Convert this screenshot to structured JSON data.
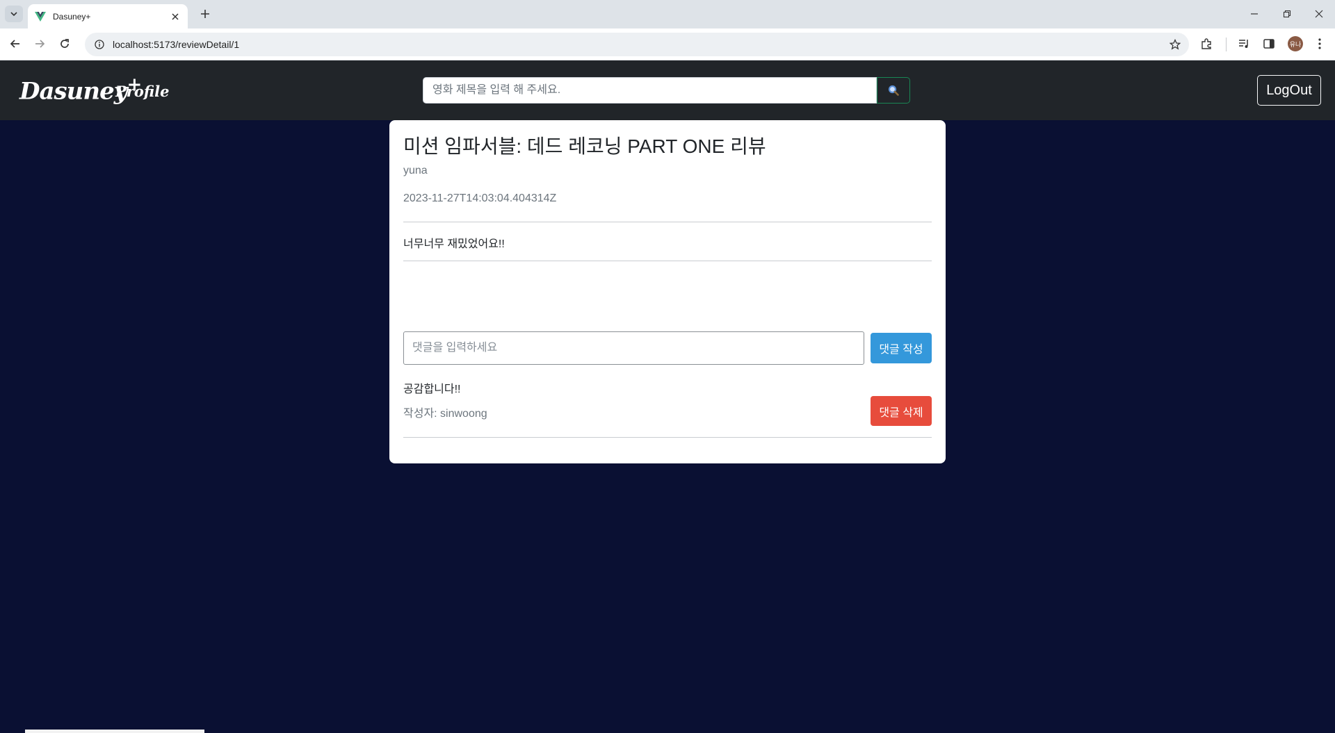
{
  "browser": {
    "tab_title": "Dasuney+",
    "url": "localhost:5173/reviewDetail/1",
    "profile_initials": "유나"
  },
  "header": {
    "logo_text": "Dasuney",
    "logo_plus": "+",
    "profile_link": "Profile",
    "search_placeholder": "영화 제목을 입력 해 주세요.",
    "search_icon": "magnifier-icon",
    "logout_label": "LogOut"
  },
  "review": {
    "title": "미션 임파서블: 데드 레코닝 PART ONE 리뷰",
    "author": "yuna",
    "date": "2023-11-27T14:03:04.404314Z",
    "content": "너무너무 재밌었어요!!"
  },
  "comment_form": {
    "placeholder": "댓글을 입력하세요",
    "submit_label": "댓글 작성"
  },
  "comments": [
    {
      "text": "공감합니다!!",
      "author": "작성자: sinwoong",
      "delete_label": "댓글 삭제"
    }
  ],
  "colors": {
    "page_bg": "#0a1033",
    "header_bg": "#212529",
    "submit_btn": "#3498db",
    "delete_btn": "#e74c3c"
  }
}
